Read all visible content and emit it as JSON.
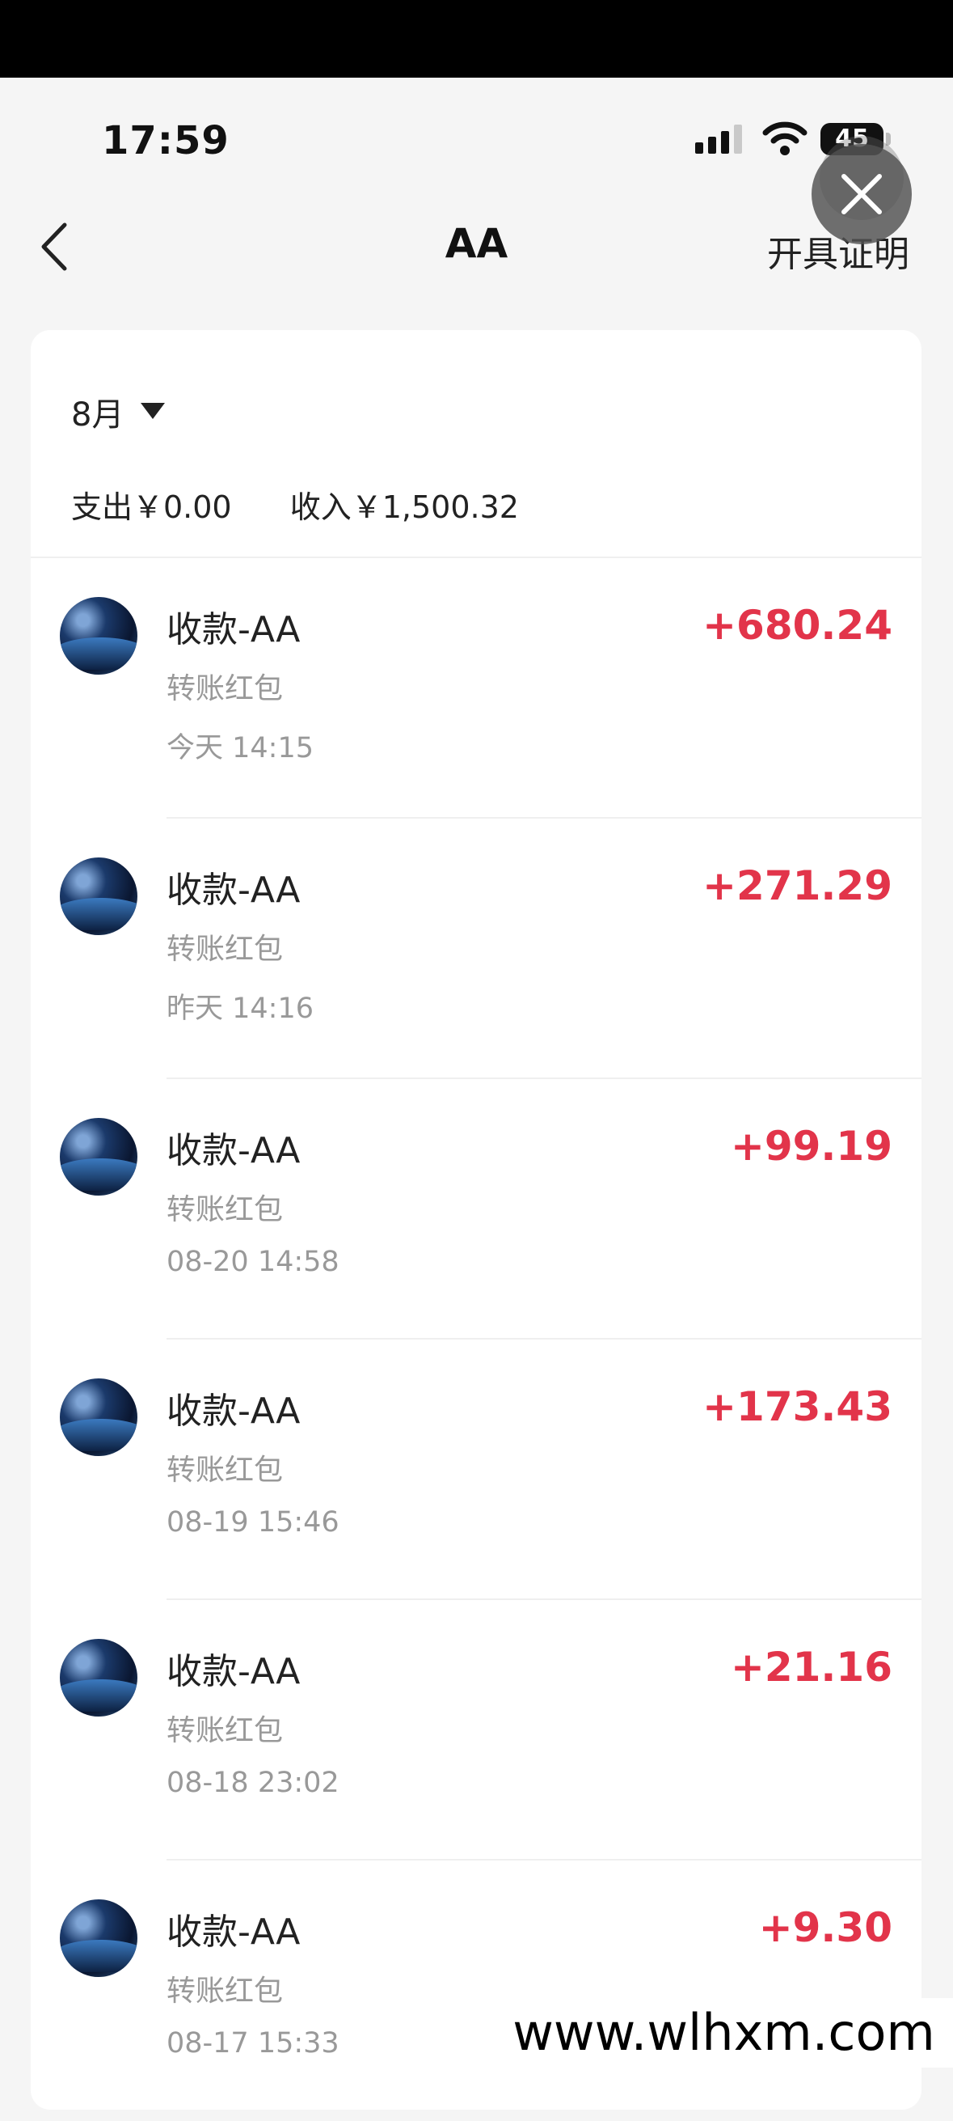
{
  "status_bar": {
    "time": "17:59",
    "battery": "45",
    "icons": [
      "signal-icon",
      "wifi-icon",
      "battery-icon"
    ]
  },
  "nav": {
    "back_icon": "chevron-left-icon",
    "title": "AA",
    "right_action": "开具证明",
    "overlay_icon": "close-icon"
  },
  "filter": {
    "month": "8月",
    "caret_icon": "triangle-down-icon"
  },
  "summary": {
    "expense": "支出￥0.00",
    "income": "收入￥1,500.32"
  },
  "transactions": [
    {
      "title": "收款-AA",
      "subtitle": "转账红包",
      "time": "今天 14:15",
      "amount": "+680.24"
    },
    {
      "title": "收款-AA",
      "subtitle": "转账红包",
      "time": "昨天 14:16",
      "amount": "+271.29"
    },
    {
      "title": "收款-AA",
      "subtitle": "转账红包",
      "time": "08-20 14:58",
      "amount": "+99.19"
    },
    {
      "title": "收款-AA",
      "subtitle": "转账红包",
      "time": "08-19 15:46",
      "amount": "+173.43"
    },
    {
      "title": "收款-AA",
      "subtitle": "转账红包",
      "time": "08-18 23:02",
      "amount": "+21.16"
    },
    {
      "title": "收款-AA",
      "subtitle": "转账红包",
      "time": "08-17 15:33",
      "amount": "+9.30"
    }
  ],
  "watermark": "www.wlhxm.com",
  "colors": {
    "amount": "#e2344a",
    "secondary_text": "#999999",
    "background": "#f5f5f5"
  }
}
